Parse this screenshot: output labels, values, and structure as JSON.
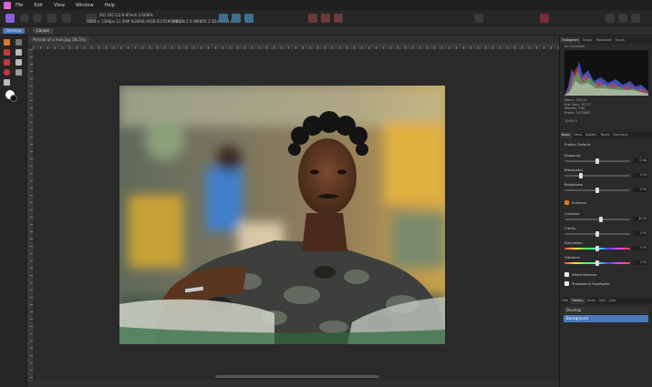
{
  "menu": {
    "items": [
      "File",
      "Edit",
      "View",
      "Window",
      "Help"
    ]
  },
  "toolbar": {
    "camera_info": "ISO 100  1/2.8  85mm  1/1600s",
    "doc_info": "1920 × 1280px  12.5MP  RGBA/8  sRGB IEC61966-2.1",
    "camera_info2": "NIKON Z 6 NIKKOR Z 85mm f/1.8 S"
  },
  "context": {
    "develop_label": "Develop",
    "cancel_label": "Cancel",
    "file_name": "Portrait of a man.jpg (36.5%)"
  },
  "panel": {
    "top_tabs": [
      "Histogram",
      "Scope",
      "Metadata",
      "Focus"
    ],
    "channel": "All Channels",
    "meta_lines": [
      "Mean: 115.14",
      "Std. Dev.: 57.27",
      "Median: 106",
      "Pixels: 2073600"
    ],
    "warn_left": "100%  0",
    "dev_tabs": [
      "Basic",
      "Lens",
      "Details",
      "Tones",
      "Overlays"
    ],
    "profile": "Profile: Default",
    "sliders": [
      {
        "label": "Exposure",
        "value": "0 ev",
        "level": 0.5
      },
      {
        "label": "Blackpoint",
        "value": "0 %",
        "level": 0.25
      },
      {
        "label": "Brightness",
        "value": "0 %",
        "level": 0.5
      }
    ],
    "enhance_label": "Enhance",
    "enhance_sliders": [
      {
        "label": "Contrast",
        "value": "10 %",
        "level": 0.55
      },
      {
        "label": "Clarity",
        "value": "0 %",
        "level": 0.5
      },
      {
        "label": "Saturation",
        "value": "0 %",
        "level": 0.5
      },
      {
        "label": "Vibrance",
        "value": "0 %",
        "level": 0.5
      }
    ],
    "white_balance": "White Balance",
    "shadows_highlights": "Shadows & Highlights",
    "bottom_tabs": [
      "Hist",
      "History",
      "Snap",
      "Info",
      "Luts"
    ],
    "list_item1": "Develop",
    "list_selected": "Background"
  },
  "colors": {
    "accent": "#4a78b8"
  }
}
